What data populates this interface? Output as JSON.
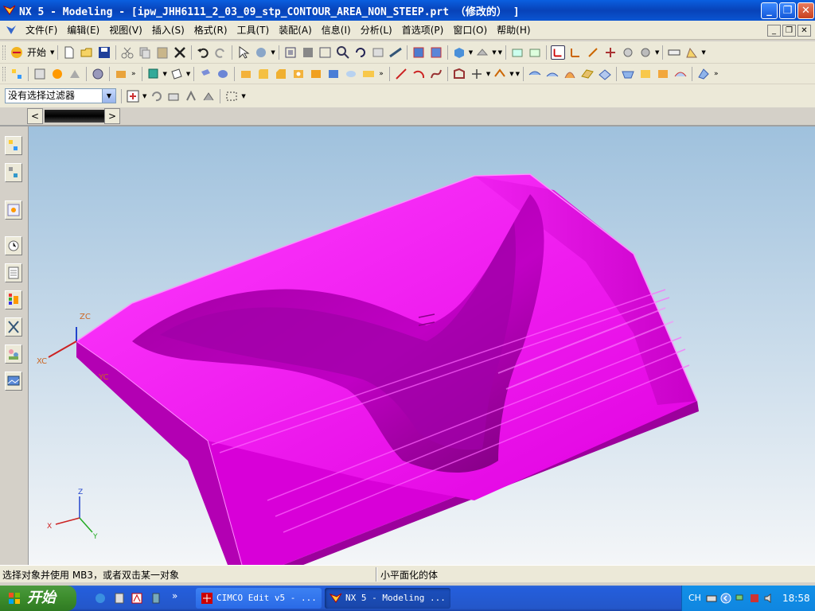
{
  "window": {
    "title": "NX 5 - Modeling - [ipw_JHH6111_2_03_09_stp_CONTOUR_AREA_NON_STEEP.prt （修改的） ]",
    "min_label": "_",
    "max_label": "❐",
    "close_label": "✕"
  },
  "menu": {
    "items": [
      "文件(F)",
      "编辑(E)",
      "视图(V)",
      "插入(S)",
      "格式(R)",
      "工具(T)",
      "装配(A)",
      "信息(I)",
      "分析(L)",
      "首选项(P)",
      "窗口(O)",
      "帮助(H)"
    ],
    "mdi_min": "_",
    "mdi_restore": "❐",
    "mdi_close": "✕"
  },
  "toolbar": {
    "start_label": "开始",
    "filter_value": "没有选择过滤器"
  },
  "resource_bar": {
    "left_arrow": "<",
    "right_arrow": ">"
  },
  "viewport": {
    "wcs_z": "ZC",
    "wcs_x": "XC",
    "wcs_y": "YC",
    "triad_z": "Z",
    "triad_x": "X",
    "triad_y": "Y",
    "model_color": "#ff00ff",
    "bg_top": "#9fc1dd",
    "bg_bottom": "#f4f6f8"
  },
  "status": {
    "prompt": "选择对象并使用 MB3，或者双击某一对象",
    "message": "小平面化的体"
  },
  "taskbar": {
    "start_label": "开始",
    "tasks": [
      {
        "label": "CIMCO Edit v5 - ..."
      },
      {
        "label": "NX 5 - Modeling ..."
      }
    ],
    "lang": "CH",
    "clock": "18:58"
  }
}
